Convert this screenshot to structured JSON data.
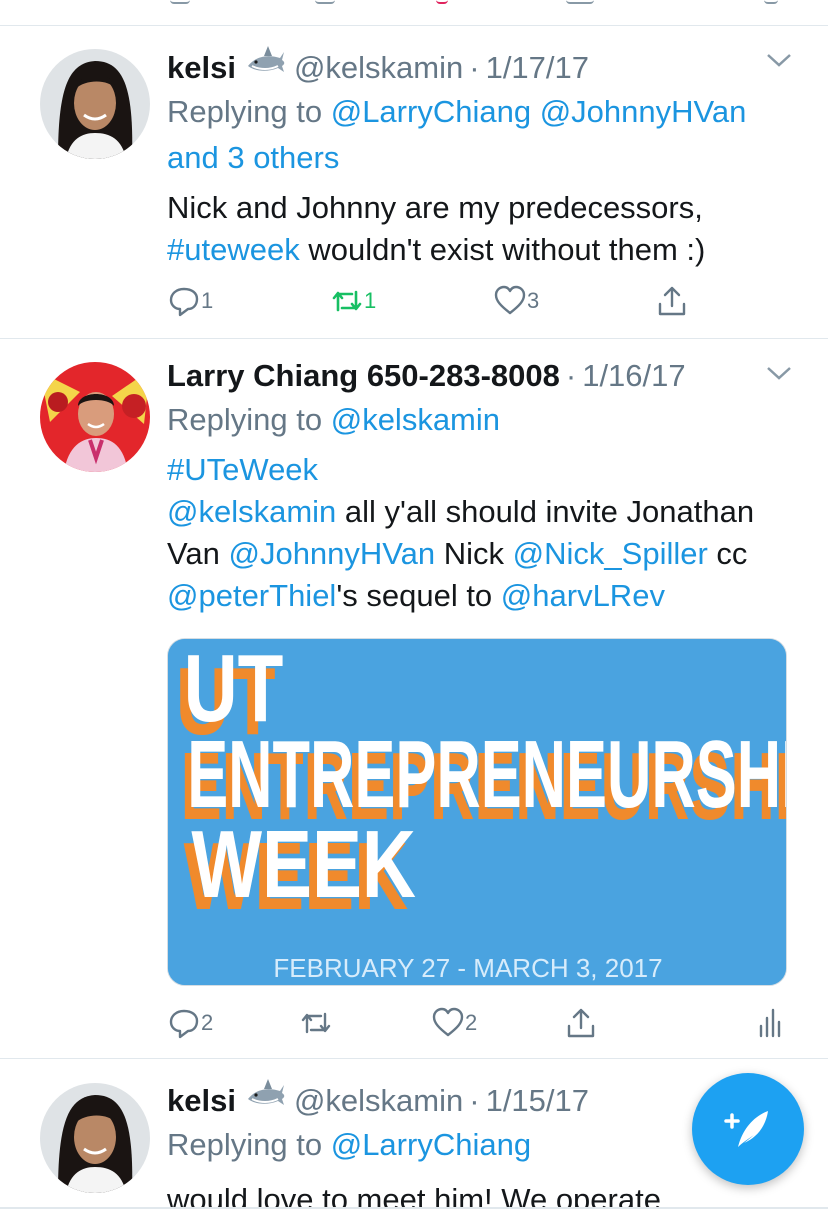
{
  "tweets": [
    {
      "name": "kelsi",
      "handle": "@kelskamin",
      "dot": "·",
      "date": "1/17/17",
      "replying_prefix": "Replying to ",
      "replying_links": [
        "@LarryChiang",
        "@JohnnyHVan"
      ],
      "replying_more": "and 3 others",
      "text_line1": "Nick and Johnny are my predecessors,",
      "hashtag": "#uteweek",
      "text_line2_rest": " wouldn't exist without them :)",
      "replies": "1",
      "retweets": "1",
      "likes": "3"
    },
    {
      "name": "Larry Chiang 650-283-8008",
      "dot": "·",
      "date": "1/16/17",
      "replying_prefix": "Replying to ",
      "replying_link": "@kelskamin",
      "hashtag": "#UTeWeek",
      "m1": "@kelskamin",
      "t1": " all y'all should invite Jonathan",
      "t2": "Van ",
      "m2": "@JohnnyHVan",
      "t3": " Nick ",
      "m3": "@Nick_Spiller",
      "t4": " cc",
      "m4": "@peterThiel",
      "t5": "'s sequel to ",
      "m5": "@harvLRev",
      "media": {
        "line1": "UT",
        "line2": "ENTREPRENEURSHIP",
        "line3": "WEEK",
        "dates": "FEBRUARY 27 - MARCH 3, 2017"
      },
      "replies": "2",
      "likes": "2"
    },
    {
      "name": "kelsi",
      "handle": "@kelskamin",
      "dot": "·",
      "date": "1/15/17",
      "replying_prefix": "Replying to ",
      "replying_link": "@LarryChiang",
      "text_partial": "would love to meet him! We operate"
    }
  ],
  "colors": {
    "link": "#1b95e0",
    "retweet_active": "#17bf63",
    "fab": "#1da1f2",
    "media_bg": "#4aa3e0",
    "media_orange": "#f08a2c"
  },
  "icons": [
    "reply-icon",
    "retweet-icon",
    "like-icon",
    "share-icon",
    "analytics-icon",
    "caret-down-icon",
    "compose-icon",
    "shark-emoji-icon"
  ]
}
